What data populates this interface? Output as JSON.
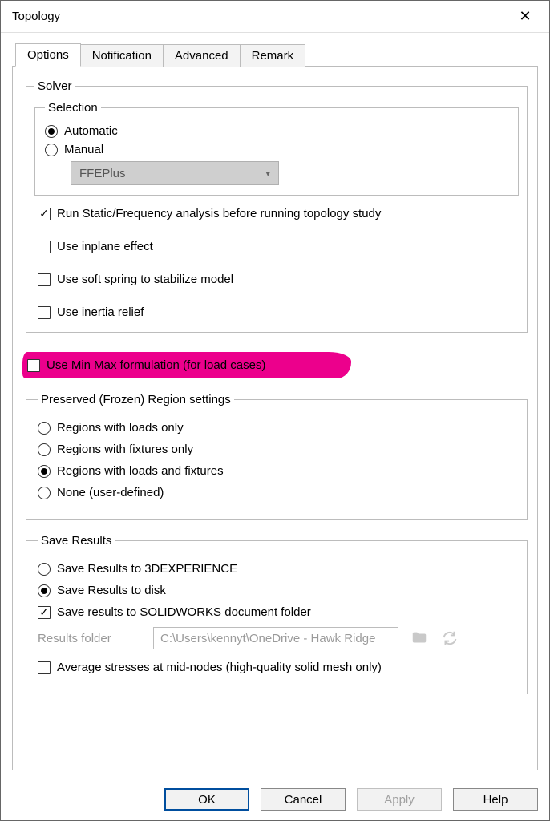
{
  "window": {
    "title": "Topology",
    "close_glyph": "✕"
  },
  "tabs": [
    {
      "label": "Options",
      "active": true
    },
    {
      "label": "Notification",
      "active": false
    },
    {
      "label": "Advanced",
      "active": false
    },
    {
      "label": "Remark",
      "active": false
    }
  ],
  "solver": {
    "legend": "Solver",
    "selection_legend": "Selection",
    "automatic": "Automatic",
    "manual": "Manual",
    "selected": "automatic",
    "dropdown_value": "FFEPlus",
    "checks": [
      {
        "key": "run_static",
        "label": "Run Static/Frequency analysis before running topology study",
        "checked": true
      },
      {
        "key": "inplane",
        "label": "Use inplane effect",
        "checked": false
      },
      {
        "key": "soft_spring",
        "label": "Use soft spring to stabilize model",
        "checked": false
      },
      {
        "key": "inertia",
        "label": "Use inertia relief",
        "checked": false
      }
    ]
  },
  "minmax": {
    "label": "Use Min Max formulation (for load cases)",
    "checked": false
  },
  "preserved": {
    "legend": "Preserved (Frozen) Region settings",
    "options": [
      {
        "key": "loads_only",
        "label": "Regions with loads only"
      },
      {
        "key": "fixtures_only",
        "label": "Regions with fixtures only"
      },
      {
        "key": "loads_fixtures",
        "label": "Regions with loads and fixtures"
      },
      {
        "key": "none",
        "label": "None (user-defined)"
      }
    ],
    "selected": "loads_fixtures"
  },
  "save_results": {
    "legend": "Save Results",
    "dest_options": [
      {
        "key": "3dx",
        "label": "Save Results to 3DEXPERIENCE"
      },
      {
        "key": "disk",
        "label": "Save Results to disk"
      }
    ],
    "dest_selected": "disk",
    "save_doc_folder": {
      "label": "Save results to SOLIDWORKS document folder",
      "checked": true
    },
    "folder_label": "Results folder",
    "folder_path": "C:\\Users\\kennyt\\OneDrive - Hawk Ridge",
    "avg_stresses": {
      "label": "Average stresses at mid-nodes (high-quality solid mesh only)",
      "checked": false
    }
  },
  "buttons": {
    "ok": "OK",
    "cancel": "Cancel",
    "apply": "Apply",
    "help": "Help"
  }
}
